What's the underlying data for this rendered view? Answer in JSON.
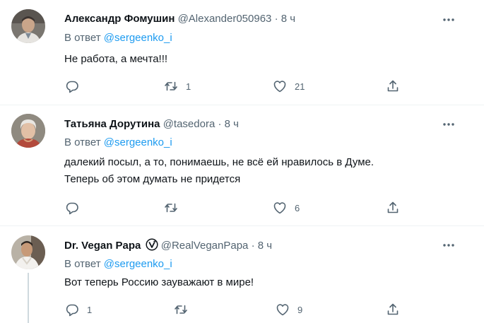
{
  "tweets": [
    {
      "name": "Александр Фомушин",
      "handle": "@Alexander050963",
      "separator": "·",
      "time": "8 ч",
      "reply_prefix": "В ответ",
      "reply_to": "@sergeenko_i",
      "text": "Не работа, а мечта!!!",
      "replies": "",
      "retweets": "1",
      "likes": "21"
    },
    {
      "name": "Татьяна Дорутина",
      "handle": "@tasedora",
      "separator": "·",
      "time": "8 ч",
      "reply_prefix": "В ответ",
      "reply_to": "@sergeenko_i",
      "text_line1": "далекий посыл, а то, понимаешь, не всё ей нравилось в Думе.",
      "text_line2": "Теперь об этом думать не придется",
      "replies": "",
      "retweets": "",
      "likes": "6"
    },
    {
      "name": "Dr. Vegan Papa",
      "badge_icon": "vegan-v-circle-icon",
      "handle": "@RealVeganPapa",
      "separator": "·",
      "time": "8 ч",
      "reply_prefix": "В ответ",
      "reply_to": "@sergeenko_i",
      "text": "Вот теперь Россию зауважают в мире!",
      "replies": "1",
      "retweets": "",
      "likes": "9"
    }
  ],
  "colors": {
    "name": "#0f1419",
    "secondary": "#536471",
    "link": "#1d9bf0",
    "divider": "#eff3f4",
    "thread_line": "#cfd9de"
  },
  "icons": [
    "reply-icon",
    "retweet-icon",
    "like-icon",
    "share-icon",
    "more-icon"
  ]
}
